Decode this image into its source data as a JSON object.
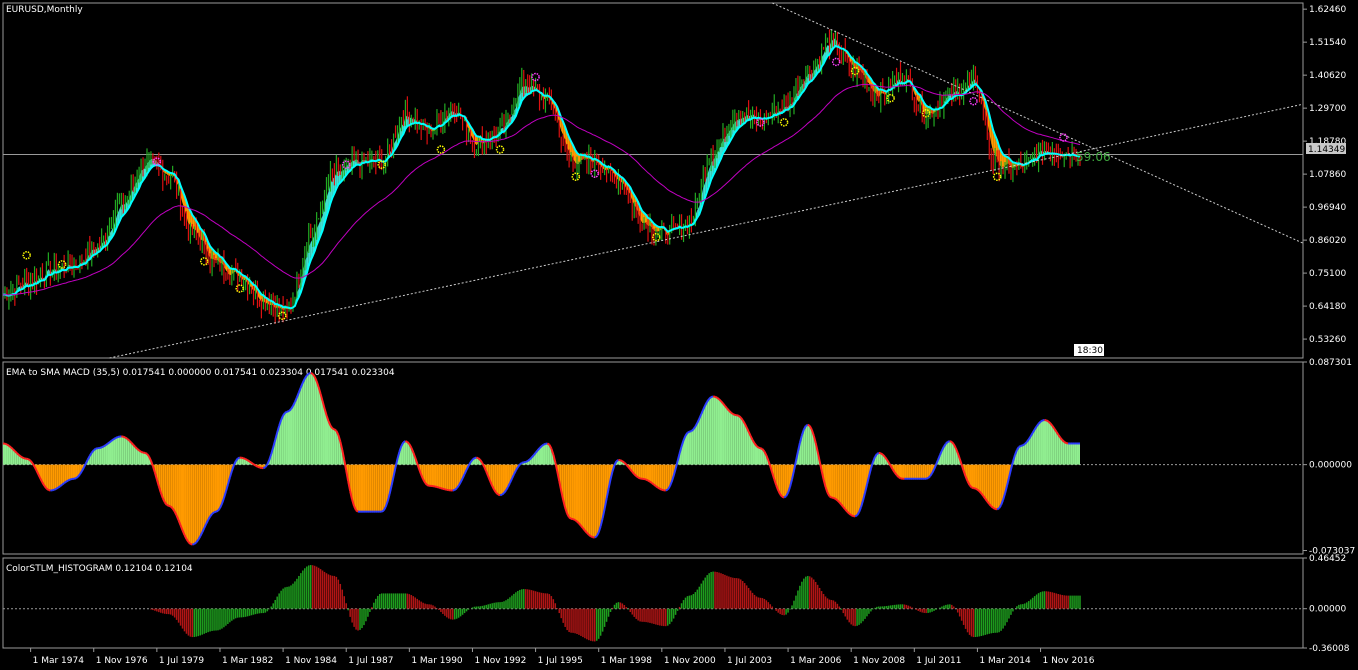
{
  "chart_data": [
    {
      "type": "line",
      "title": "EURUSD,Monthly",
      "yticks": [
        "1.62460",
        "1.51540",
        "1.40620",
        "1.29700",
        "1.18780",
        "1.07860",
        "0.96940",
        "0.86020",
        "0.75100",
        "0.64180",
        "0.53260"
      ],
      "ylim": [
        0.47,
        1.645
      ],
      "price_label": "1.14349",
      "countdown": "59:06",
      "clock": "18:30",
      "price_series_x": [
        1973,
        1974,
        1975,
        1976,
        1977,
        1978,
        1979,
        1980,
        1981,
        1982,
        1983,
        1984,
        1985,
        1986,
        1987,
        1988,
        1989,
        1990,
        1991,
        1992,
        1993,
        1994,
        1995,
        1996,
        1997,
        1998,
        1999,
        2000,
        2001,
        2002,
        2003,
        2004,
        2005,
        2006,
        2007,
        2008,
        2009,
        2010,
        2011,
        2012,
        2013,
        2014,
        2015,
        2016,
        2017,
        2018
      ],
      "price_series_y": [
        0.68,
        0.72,
        0.76,
        0.78,
        0.84,
        0.98,
        1.12,
        1.08,
        0.88,
        0.78,
        0.74,
        0.66,
        0.62,
        0.88,
        1.08,
        1.12,
        1.12,
        1.28,
        1.22,
        1.3,
        1.18,
        1.22,
        1.38,
        1.32,
        1.12,
        1.12,
        1.06,
        0.92,
        0.88,
        0.92,
        1.16,
        1.28,
        1.26,
        1.3,
        1.42,
        1.52,
        1.42,
        1.34,
        1.4,
        1.28,
        1.34,
        1.38,
        1.1,
        1.1,
        1.16,
        1.15
      ]
    },
    {
      "type": "area",
      "title": "EMA to SMA MACD (35,5) 0.017541 0.000000 0.017541 0.023304 0.017541 0.023304",
      "yticks": [
        "0.087301",
        "0.000000",
        "-0.073037"
      ],
      "ylim": [
        -0.076,
        0.0873
      ],
      "x": [
        1973,
        1974,
        1975,
        1976,
        1977,
        1978,
        1979,
        1980,
        1981,
        1982,
        1983,
        1984,
        1985,
        1986,
        1987,
        1988,
        1989,
        1990,
        1991,
        1992,
        1993,
        1994,
        1995,
        1996,
        1997,
        1998,
        1999,
        2000,
        2001,
        2002,
        2003,
        2004,
        2005,
        2006,
        2007,
        2008,
        2009,
        2010,
        2011,
        2012,
        2013,
        2014,
        2015,
        2016,
        2017,
        2018
      ],
      "values": [
        0.018,
        0.005,
        -0.022,
        -0.012,
        0.014,
        0.024,
        0.01,
        -0.035,
        -0.068,
        -0.04,
        0.006,
        -0.003,
        0.045,
        0.078,
        0.03,
        -0.04,
        -0.04,
        0.02,
        -0.018,
        -0.022,
        0.006,
        -0.026,
        0.002,
        0.018,
        -0.046,
        -0.062,
        0.004,
        -0.012,
        -0.022,
        0.028,
        0.058,
        0.042,
        0.014,
        -0.028,
        0.034,
        -0.028,
        -0.044,
        0.01,
        -0.012,
        -0.012,
        0.02,
        -0.02,
        -0.038,
        0.016,
        0.038,
        0.018
      ]
    },
    {
      "type": "bar",
      "title": "ColorSTLM_HISTOGRAM 0.12104 0.12104",
      "yticks": [
        "0.46452",
        "0.00000",
        "-0.36008"
      ],
      "ylim": [
        -0.36,
        0.4645
      ],
      "x": [
        1973,
        1974,
        1975,
        1976,
        1977,
        1978,
        1979,
        1980,
        1981,
        1982,
        1983,
        1984,
        1985,
        1986,
        1987,
        1988,
        1989,
        1990,
        1991,
        1992,
        1993,
        1994,
        1995,
        1996,
        1997,
        1998,
        1999,
        2000,
        2001,
        2002,
        2003,
        2004,
        2005,
        2006,
        2007,
        2008,
        2009,
        2010,
        2011,
        2012,
        2013,
        2014,
        2015,
        2016,
        2017,
        2018
      ],
      "values": [
        0.0,
        0.0,
        0.0,
        0.0,
        0.0,
        0.0,
        0.0,
        -0.05,
        -0.26,
        -0.2,
        -0.08,
        -0.04,
        0.2,
        0.4,
        0.3,
        -0.2,
        0.14,
        0.14,
        0.04,
        -0.1,
        0.02,
        0.06,
        0.18,
        0.14,
        -0.22,
        -0.3,
        0.06,
        -0.12,
        -0.16,
        0.12,
        0.34,
        0.28,
        0.1,
        -0.06,
        0.3,
        0.08,
        -0.16,
        0.02,
        0.04,
        -0.04,
        0.04,
        -0.26,
        -0.22,
        0.04,
        0.16,
        0.12
      ],
      "xlabels": [
        "1 Mar 1974",
        "1 Nov 1976",
        "1 Jul 1979",
        "1 Mar 1982",
        "1 Nov 1984",
        "1 Jul 1987",
        "1 Mar 1990",
        "1 Nov 1992",
        "1 Jul 1995",
        "1 Mar 1998",
        "1 Nov 2000",
        "1 Jul 2003",
        "1 Mar 2006",
        "1 Nov 2008",
        "1 Jul 2011",
        "1 Mar 2014",
        "1 Nov 2016"
      ]
    }
  ],
  "colors": {
    "background": "#000000",
    "grid": "#9a9a9a",
    "up_bar": "#22aa22",
    "down_bar": "#dd1111",
    "cloud_up": "#40e0d0",
    "cloud_down": "#ff9a00",
    "ma_line": "#00ffff",
    "long_ma": "#c000c0",
    "trendline": "#cccccc",
    "macd_up_fill": "#90ee90",
    "macd_down_fill": "#ff9a00",
    "macd_line_blue": "#2b3cff",
    "macd_line_red": "#ff2020",
    "hist_up": "#1e9e1e",
    "hist_down": "#b01515",
    "price_label_bg": "#c8c8c8",
    "countdown": "#3fa83f"
  }
}
